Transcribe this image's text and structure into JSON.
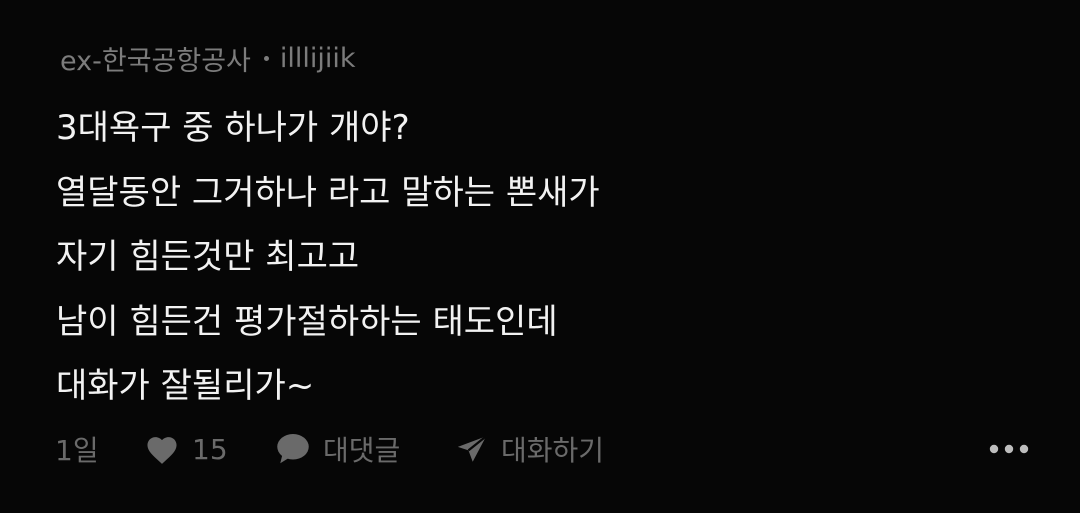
{
  "comment": {
    "company": "ex-한국공항공사",
    "username": "illlijiik",
    "lines": [
      "3대욕구 중 하나가 개야?",
      "열달동안 그거하나 라고 말하는 뽄새가",
      "자기 힘든것만 최고고",
      "남이 힘든건 평가절하하는 태도인데",
      "대화가 잘될리가~"
    ],
    "time": "1일",
    "like_count": "15",
    "reply_label": "대댓글",
    "chat_label": "대화하기"
  },
  "icons": {
    "like": "heart-icon",
    "reply": "speech-bubble-icon",
    "chat": "paper-plane-icon",
    "more": "more-dots-icon"
  },
  "colors": {
    "background": "#060606",
    "text": "#f2f2f2",
    "meta": "#7c7c7c",
    "action": "#6a6a6a"
  }
}
